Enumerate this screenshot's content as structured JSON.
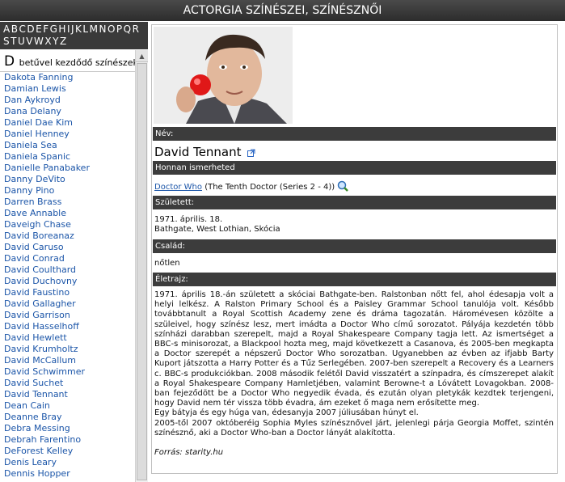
{
  "title": "ACTORGIA SZÍNÉSZEI, SZÍNÉSZNŐI",
  "letters": [
    "A",
    "B",
    "C",
    "D",
    "E",
    "F",
    "G",
    "H",
    "I",
    "J",
    "K",
    "L",
    "M",
    "N",
    "O",
    "P",
    "Q",
    "R",
    "S",
    "T",
    "U",
    "V",
    "W",
    "X",
    "Y",
    "Z"
  ],
  "list": {
    "header_letter": "D",
    "header_text": "betűvel kezdődő színészek",
    "names": [
      "Dakota Fanning",
      "Damian Lewis",
      "Dan Aykroyd",
      "Dana Delany",
      "Daniel Dae Kim",
      "Daniel Henney",
      "Daniela Sea",
      "Daniela Spanic",
      "Danielle Panabaker",
      "Danny DeVito",
      "Danny Pino",
      "Darren Brass",
      "Dave Annable",
      "Daveigh Chase",
      "David Boreanaz",
      "David Caruso",
      "David Conrad",
      "David Coulthard",
      "David Duchovny",
      "David Faustino",
      "David Gallagher",
      "David Garrison",
      "David Hasselhoff",
      "David Hewlett",
      "David Krumholtz",
      "David McCallum",
      "David Schwimmer",
      "David Suchet",
      "David Tennant",
      "Dean Cain",
      "Deanne Bray",
      "Debra Messing",
      "Debrah Farentino",
      "DeForest Kelley",
      "Denis Leary",
      "Dennis Hopper"
    ]
  },
  "profile": {
    "name_label": "Név:",
    "name": "David Tennant",
    "known_label": "Honnan ismerheted",
    "known_link": "Doctor Who",
    "known_rest": "(The Tenth Doctor (Series 2 - 4))",
    "born_label": "Született:",
    "born_date": "1971. április. 18.",
    "born_place": "Bathgate, West Lothian, Skócia",
    "family_label": "Család:",
    "family": "nőtlen",
    "bio_label": "Életrajz:",
    "bio": [
      "1971. április 18.-án született a skóciai Bathgate-ben. Ralstonban nőtt fel, ahol édesapja volt a helyi lelkész. A Ralston Primary School és a Paisley Grammar School tanulója volt. Később továbbtanult a Royal Scottish Academy zene és dráma tagozatán. Háromévesen közölte a szüleivel, hogy színész lesz, mert imádta a Doctor Who című sorozatot. Pályája kezdetén több színházi darabban szerepelt, majd a Royal Shakespeare Company tagja lett. Az ismertséget a BBC-s minisorozat, a Blackpool hozta meg, majd következett a Casanova, és 2005-ben megkapta a Doctor szerepét a népszerű Doctor Who sorozatban. Ugyanebben az évben az ifjabb Barty Kuport játszotta a Harry Potter és a Tűz Serlegében. 2007-ben szerepelt a Recovery és a Learners c. BBC-s produkciókban. 2008 második felétől David visszatért a színpadra, és címszerepet alakít a Royal Shakespeare Company Hamletjében, valamint Berowne-t a Lóvátett Lovagokban. 2008-ban fejeződött be a Doctor Who negyedik évada, és ezután olyan pletykák kezdtek terjengeni, hogy David nem tér vissza több évadra, ám ezeket ő maga nem erősítette meg.",
      "Egy bátyja és egy húga van, édesanyja 2007 júliusában húnyt el.",
      "2005-től 2007 októberéig Sophia Myles színésznővel járt, jelenlegi párja Georgia Moffet, szintén színésznő, aki a Doctor Who-ban a Doctor lányát alakította."
    ],
    "source": "Forrás: starity.hu"
  }
}
